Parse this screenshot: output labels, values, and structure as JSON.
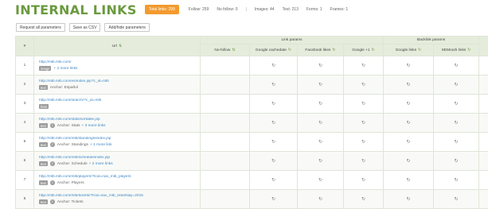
{
  "header": {
    "title": "INTERNAL LINKS",
    "total_badge": "Total links: 299",
    "stats": [
      "Follow: 259",
      "No follow: 0",
      "Images: 44",
      "Text: 213",
      "Forms: 1",
      "Frames: 1"
    ],
    "separator": "|"
  },
  "toolbar": {
    "request_all": "Request all parameters",
    "save_csv": "Save as CSV",
    "add_hide": "Add/hide parameters"
  },
  "table": {
    "col_num": "#",
    "col_url": "Url",
    "group_link_params": "Link params",
    "group_backlink_params": "Backlink params",
    "col_nofollow": "No-follow",
    "col_google_cache": "Google cachedate",
    "col_facebook": "Facebook likes",
    "col_gplus": "Google +1",
    "col_google_links": "Google links",
    "col_semrush": "SEMrush links",
    "refresh_glyph": "↻",
    "sort_glyph": "⇅",
    "rows": [
      {
        "num": "1",
        "url": "http://mlb.mlb.com/",
        "tag": "image",
        "count": "",
        "anchor": "",
        "more": "+ 2 more links"
      },
      {
        "num": "2",
        "url": "http://mlb.mlb.com/es/index.jsp?c_id=mlb",
        "tag": "text",
        "count": "",
        "anchor": "Anchor: Español",
        "more": ""
      },
      {
        "num": "3",
        "url": "http://mlb.mlb.com/search/?c_id=mlb",
        "tag": "form",
        "count": "",
        "anchor": "",
        "more": ""
      },
      {
        "num": "4",
        "url": "http://mlb.mlb.com/stats/sortable.jsp",
        "tag": "text",
        "count": "2",
        "anchor": "Anchor: Stats",
        "more": "+ 3 more links"
      },
      {
        "num": "5",
        "url": "http://mlb.mlb.com/mlb/standings/index.jsp",
        "tag": "text",
        "count": "2",
        "anchor": "Anchor: Standings",
        "more": "+ 1 more link"
      },
      {
        "num": "6",
        "url": "http://mlb.mlb.com/mlb/schedule/index.jsp",
        "tag": "text",
        "count": "2",
        "anchor": "Anchor: Schedule",
        "more": "+ 2 more links"
      },
      {
        "num": "7",
        "url": "http://mlb.mlb.com/mlb/players/?tcid=nav_mlb_players",
        "tag": "text",
        "count": "2",
        "anchor": "Anchor: Players",
        "more": ""
      },
      {
        "num": "8",
        "url": "http://mlb.mlb.com/mlb/tickets/?tcid=nav_mlb_tickets&y=2015",
        "tag": "text",
        "count": "2",
        "anchor": "Anchor: Tickets",
        "more": ""
      }
    ]
  }
}
